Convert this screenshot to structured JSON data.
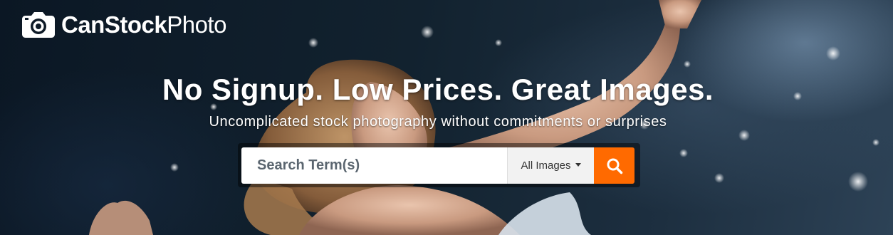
{
  "brand": {
    "name_bold": "CanStock",
    "name_light": "Photo"
  },
  "hero": {
    "headline": "No Signup. Low Prices. Great Images.",
    "subheadline": "Uncomplicated stock photography without commitments or surprises"
  },
  "search": {
    "placeholder": "Search Term(s)",
    "type_selected": "All Images",
    "button_icon": "search-icon",
    "button_color": "#ff6a00"
  },
  "colors": {
    "accent": "#ff6a00",
    "text_on_hero": "#ffffff"
  }
}
